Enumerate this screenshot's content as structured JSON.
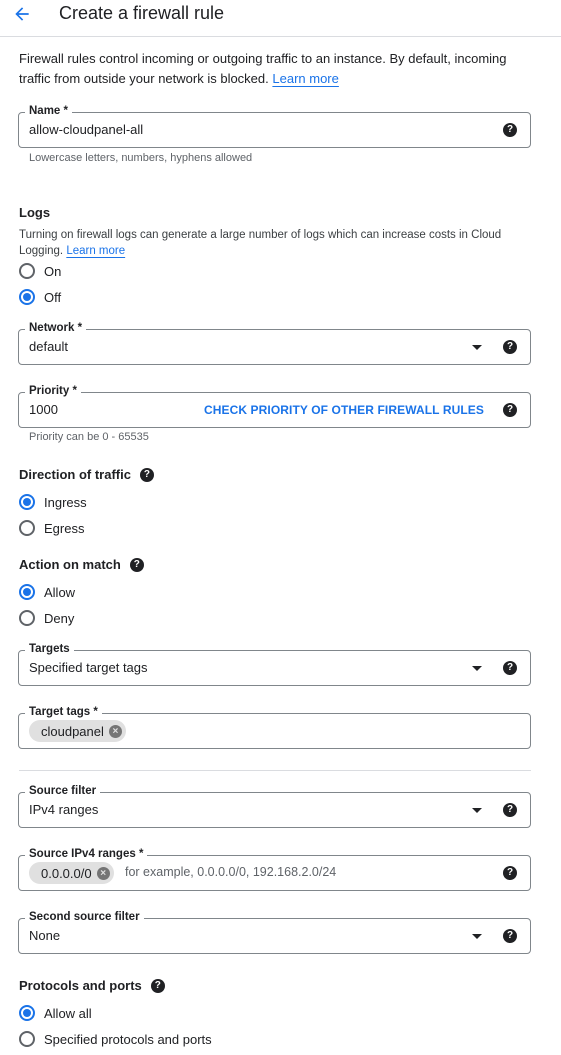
{
  "header": {
    "title": "Create a firewall rule",
    "back_icon": "arrow-back-icon"
  },
  "intro": {
    "text": "Firewall rules control incoming or outgoing traffic to an instance. By default, incoming traffic from outside your network is blocked.",
    "link": "Learn more"
  },
  "name_field": {
    "label": "Name *",
    "value": "allow-cloudpanel-all",
    "hint": "Lowercase letters, numbers, hyphens allowed"
  },
  "logs": {
    "title": "Logs",
    "text": "Turning on firewall logs can generate a large number of logs which can increase costs in Cloud Logging.",
    "link": "Learn more",
    "options": [
      {
        "label": "On",
        "selected": false
      },
      {
        "label": "Off",
        "selected": true
      }
    ]
  },
  "network": {
    "label": "Network *",
    "value": "default"
  },
  "priority": {
    "label": "Priority *",
    "value": "1000",
    "action": "CHECK PRIORITY OF OTHER FIREWALL RULES",
    "hint": "Priority can be 0 - 65535"
  },
  "direction": {
    "title": "Direction of traffic",
    "options": [
      {
        "label": "Ingress",
        "selected": true
      },
      {
        "label": "Egress",
        "selected": false
      }
    ]
  },
  "action": {
    "title": "Action on match",
    "options": [
      {
        "label": "Allow",
        "selected": true
      },
      {
        "label": "Deny",
        "selected": false
      }
    ]
  },
  "targets": {
    "label": "Targets",
    "value": "Specified target tags"
  },
  "target_tags": {
    "label": "Target tags *",
    "chips": [
      "cloudpanel"
    ]
  },
  "source_filter": {
    "label": "Source filter",
    "value": "IPv4 ranges"
  },
  "source_ranges": {
    "label": "Source IPv4 ranges *",
    "chips": [
      "0.0.0.0/0"
    ],
    "placeholder": "for example, 0.0.0.0/0, 192.168.2.0/24"
  },
  "second_source_filter": {
    "label": "Second source filter",
    "value": "None"
  },
  "protocols": {
    "title": "Protocols and ports",
    "options": [
      {
        "label": "Allow all",
        "selected": true
      },
      {
        "label": "Specified protocols and ports",
        "selected": false
      }
    ]
  },
  "help_glyph": "?",
  "chip_remove_glyph": "×",
  "accent_color": "#1a73e8"
}
